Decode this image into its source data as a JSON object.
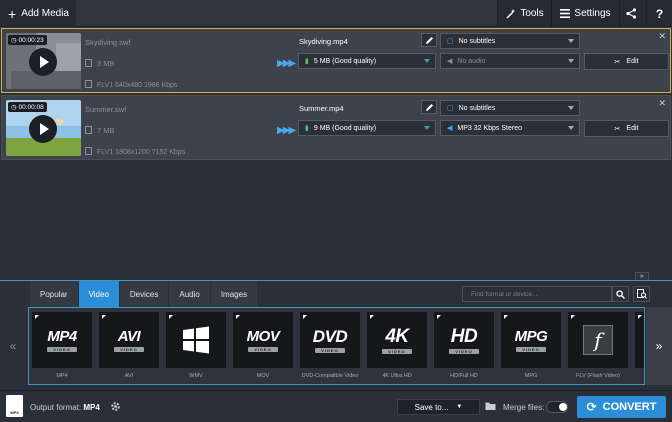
{
  "toolbar": {
    "add_media": "Add Media",
    "tools": "Tools",
    "settings": "Settings",
    "help": "?"
  },
  "files": [
    {
      "duration": "00:00:23",
      "source_name": "Skydiving.swf",
      "source_size": "3 MB",
      "source_meta": "FLV1 640x480 1986 Kbps",
      "output_name": "Skydiving.mp4",
      "output_size": "5 MB (Good quality)",
      "subtitles": "No subtitles",
      "audio": "No audio",
      "edit": "Edit",
      "selected": true,
      "audio_disabled": true
    },
    {
      "duration": "00:00:08",
      "source_name": "Summer.swf",
      "source_size": "7 MB",
      "source_meta": "FLV1 1808x1200 7152 Kbps",
      "output_name": "Summer.mp4",
      "output_size": "9 MB (Good quality)",
      "subtitles": "No subtitles",
      "audio": "MP3 32 Kbps Stereo",
      "edit": "Edit",
      "selected": false,
      "audio_disabled": false
    }
  ],
  "tabs": [
    "Popular",
    "Video",
    "Devices",
    "Audio",
    "Images"
  ],
  "active_tab": "Video",
  "search": {
    "placeholder": "Find format or device..."
  },
  "formats": [
    {
      "icon": "MP4",
      "sub": "VIDEO",
      "label": "MP4"
    },
    {
      "icon": "AVI",
      "sub": "VIDEO",
      "label": "AVI"
    },
    {
      "icon": "windows-logo",
      "sub": "",
      "label": "WMV"
    },
    {
      "icon": "MOV",
      "sub": "VIDEO",
      "label": "MOV"
    },
    {
      "icon": "DVD",
      "sub": "VIDEO",
      "label": "DVD-Compatible Video"
    },
    {
      "icon": "4K",
      "sub": "VIDEO",
      "label": "4K Ultra HD"
    },
    {
      "icon": "HD",
      "sub": "VIDEO",
      "label": "HD/Full HD"
    },
    {
      "icon": "MPG",
      "sub": "VIDEO",
      "label": "MPG"
    },
    {
      "icon": "flash-logo",
      "sub": "",
      "label": "FLV (Flash Video)"
    }
  ],
  "bottom": {
    "output_label": "Output format:",
    "output_value": "MP4",
    "save_to": "Save to...",
    "merge_files": "Merge files:",
    "convert": "CONVERT",
    "format_icon_text": "MP4"
  },
  "colors": {
    "accent": "#2d8ed8",
    "selection": "#d7b23d",
    "panel_border": "#3a9db5"
  }
}
